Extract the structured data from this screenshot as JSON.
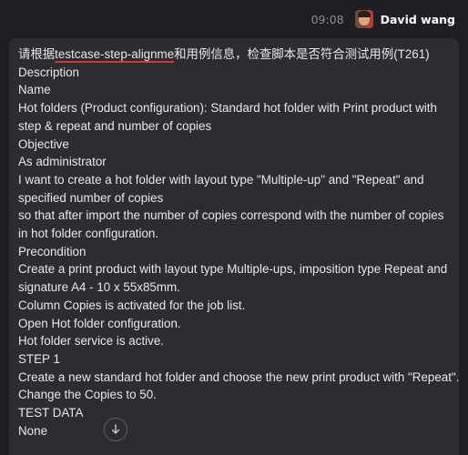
{
  "header": {
    "time": "09:08",
    "username": "David wang"
  },
  "message": {
    "first_line": {
      "prefix": "请根据",
      "keyword": "testcase-step-alignme",
      "suffix": "和用例信息，检查脚本是否符合测试用例(T261)"
    },
    "lines": [
      "Description",
      "Name",
      "Hot folders (Product configuration): Standard hot folder with Print product with",
      "step & repeat and number of copies",
      "Objective",
      "As administrator",
      "I want to create a hot folder with layout type \"Multiple-up\" and \"Repeat\" and",
      "specified number of copies",
      "so that after import the number of copies correspond with the number of copies",
      "in hot folder configuration.",
      "Precondition",
      "Create a print product with layout type Multiple-ups, imposition type Repeat and",
      "signature A4 - 10 x 55x85mm.",
      "Column Copies is activated for the job list.",
      "Open Hot folder configuration.",
      "Hot folder service is active.",
      "STEP 1",
      "Create a new standard hot folder and choose the new print product with \"Repeat\".",
      "Change the Copies to 50.",
      "TEST DATA",
      "None"
    ]
  },
  "scroll_button": {
    "icon": "arrow-down-icon"
  }
}
